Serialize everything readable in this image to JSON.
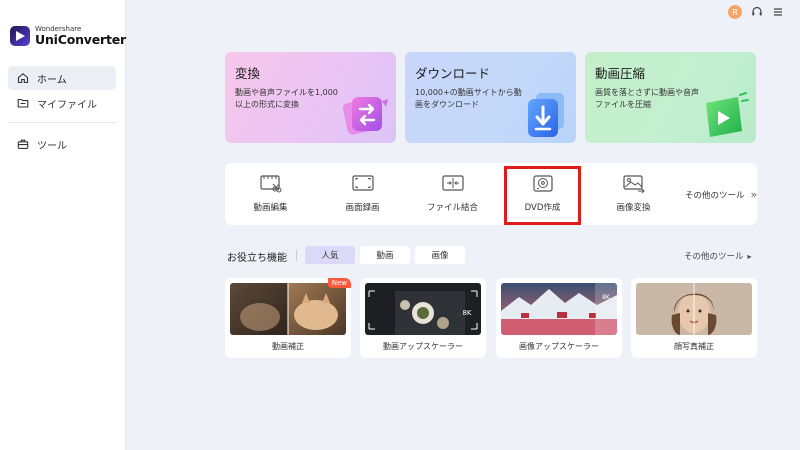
{
  "app": {
    "brand_small": "Wondershare",
    "brand_big": "UniConverter"
  },
  "sidebar": {
    "items": [
      {
        "label": "ホーム",
        "icon": "home-icon",
        "active": true
      },
      {
        "label": "マイファイル",
        "icon": "folder-icon",
        "active": false
      },
      {
        "label": "ツール",
        "icon": "toolbox-icon",
        "active": false
      }
    ]
  },
  "topbar": {
    "avatar_initial": "R",
    "icons": [
      "avatar",
      "headset-icon",
      "menu-icon"
    ]
  },
  "features": [
    {
      "title": "変換",
      "desc": "動画や音声ファイルを1,000以上の形式に変換",
      "icon": "convert-icon"
    },
    {
      "title": "ダウンロード",
      "desc": "10,000+の動画サイトから動画をダウンロード",
      "icon": "download-icon"
    },
    {
      "title": "動画圧縮",
      "desc": "画質を落とさずに動画や音声ファイルを圧縮",
      "icon": "compress-icon"
    }
  ],
  "tools": [
    {
      "label": "動画編集",
      "icon": "video-edit-icon"
    },
    {
      "label": "画面録画",
      "icon": "screen-record-icon"
    },
    {
      "label": "ファイル結合",
      "icon": "merge-icon"
    },
    {
      "label": "DVD作成",
      "icon": "dvd-icon"
    },
    {
      "label": "画像変換",
      "icon": "image-convert-icon"
    }
  ],
  "tools_more": "その他のツール",
  "help": {
    "title": "お役立ち機能",
    "chips": [
      "人気",
      "動画",
      "画像"
    ],
    "active_chip": "人気",
    "more": "その他のツール"
  },
  "cards": [
    {
      "label": "動画補正",
      "badge": "New"
    },
    {
      "label": "動画アップスケーラー",
      "badge": ""
    },
    {
      "label": "画像アップスケーラー",
      "badge": ""
    },
    {
      "label": "顔写真補正",
      "badge": ""
    }
  ],
  "card_overlay": {
    "upscale_8k": "8K"
  },
  "colors": {
    "highlight_box": "#e21b1b",
    "active_chip": "#dcd8f7",
    "badge_new": "#ff5a3c"
  }
}
